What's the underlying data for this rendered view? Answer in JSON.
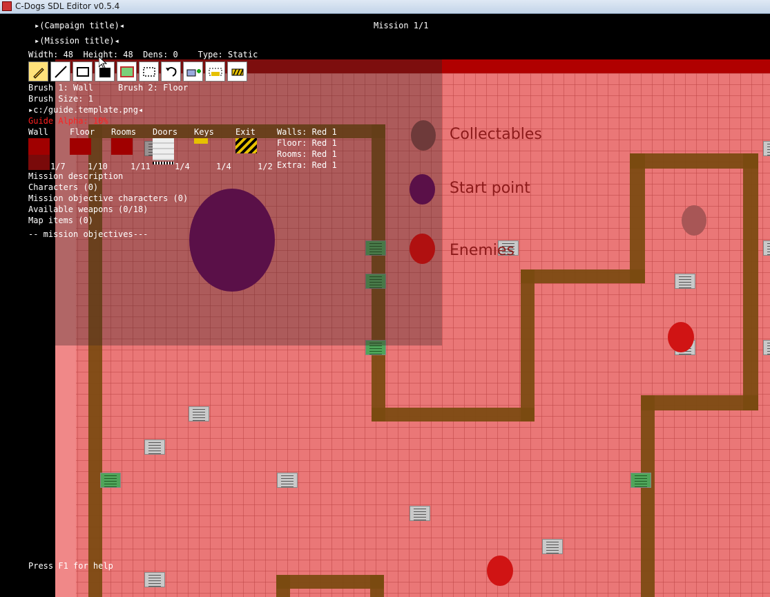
{
  "window": {
    "title": "C-Dogs SDL Editor v0.5.4"
  },
  "header": {
    "campaign_title": "▸(Campaign title)◂",
    "mission_title": "▸(Mission title)◂",
    "mission_counter": "Mission 1/1",
    "map_info": "Width: 48  Height: 48  Dens: 0    Type: Static"
  },
  "toolbar": {
    "tools": [
      "pencil",
      "line",
      "rectangle",
      "fill",
      "room",
      "select",
      "undo",
      "add-item",
      "add-key",
      "exit"
    ]
  },
  "brush": {
    "brush_line": "Brush 1: Wall     Brush 2: Floor",
    "size_line": "Brush Size: 1",
    "guide_file": "▸c:/guide.template.png◂",
    "guide_alpha": "Guide Alpha: 10%"
  },
  "palette": {
    "headers": [
      "Wall",
      "Floor",
      "Rooms",
      "Doors",
      "Keys",
      "Exit"
    ],
    "counts": [
      "1/7",
      "1/10",
      "1/11",
      "1/4",
      "1/4",
      "1/2"
    ],
    "colors_lines": [
      "Walls: Red 1",
      "Floor: Red 1",
      "Rooms: Red 1",
      "Extra: Red 1"
    ]
  },
  "menu": {
    "items": [
      "Mission description",
      "Characters (0)",
      "Mission objective characters (0)",
      "Available weapons (0/18)",
      "Map items (0)",
      "-- mission objectives---"
    ]
  },
  "legend": {
    "collectables": "Collectables",
    "start_point": "Start point",
    "enemies": "Enemies"
  },
  "footer": {
    "help": "Press F1 for help"
  },
  "colors": {
    "floor": "#ea7777",
    "wall": "#7a4a10",
    "accent_red": "#ff2020"
  }
}
